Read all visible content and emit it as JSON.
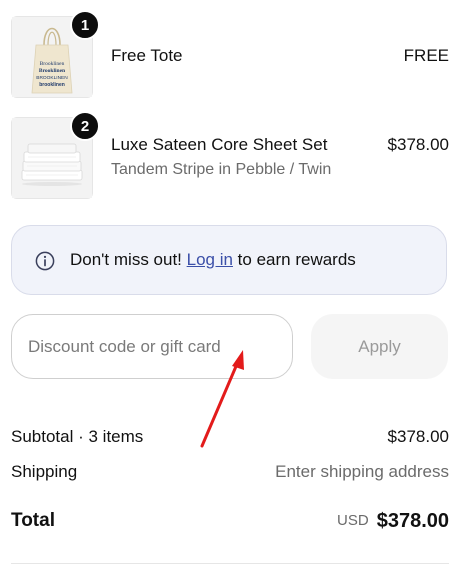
{
  "line_items": [
    {
      "quantity": "1",
      "name": "Free Tote",
      "variant": "",
      "price": "FREE",
      "tote_print": [
        "Brooklinen",
        "Brooklinen",
        "BROOKLINEN",
        "brooklinen"
      ]
    },
    {
      "quantity": "2",
      "name": "Luxe Sateen Core Sheet Set",
      "variant": "Tandem Stripe in Pebble / Twin",
      "price": "$378.00"
    }
  ],
  "rewards_banner": {
    "text_before": "Don't miss out! ",
    "link_label": "Log in",
    "text_after": " to earn rewards"
  },
  "discount": {
    "placeholder": "Discount code or gift card",
    "value": "",
    "apply_label": "Apply"
  },
  "summary": {
    "subtotal_label": "Subtotal · 3 items",
    "subtotal_value": "$378.00",
    "shipping_label": "Shipping",
    "shipping_value": "Enter shipping address",
    "total_label": "Total",
    "total_currency": "USD",
    "total_value": "$378.00"
  },
  "colors": {
    "link": "#3b4fa8",
    "banner_bg": "#f1f3fa",
    "annotation_arrow": "#e31b1b"
  },
  "icons": {
    "info": "info-circle-icon"
  }
}
